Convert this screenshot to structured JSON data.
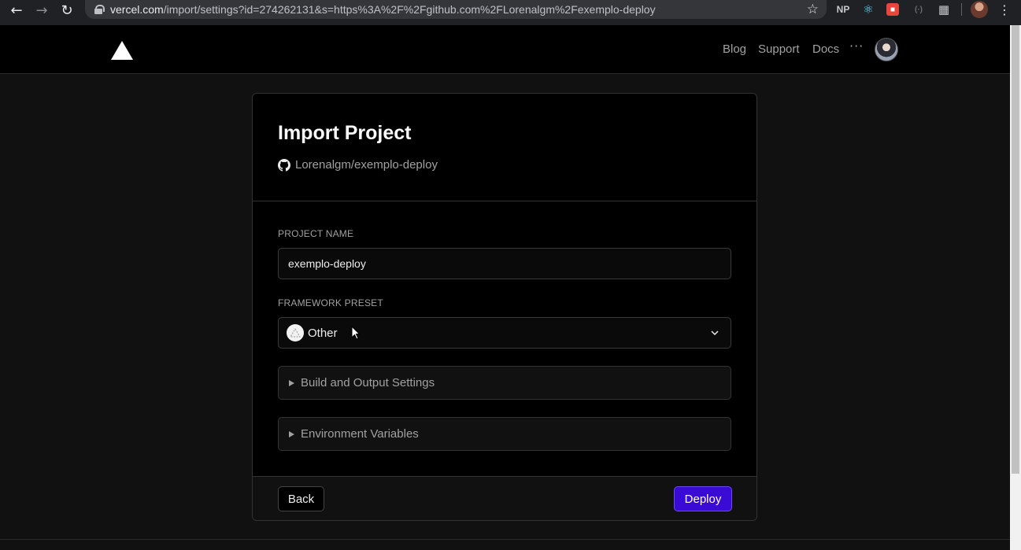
{
  "browser": {
    "url_host": "vercel.com",
    "url_path": "/import/settings?id=274262131&s=https%3A%2F%2Fgithub.com%2FLorenalgm%2Fexemplo-deploy",
    "extensions": [
      "NP"
    ]
  },
  "header": {
    "nav": {
      "blog": "Blog",
      "support": "Support",
      "docs": "Docs",
      "more": "···"
    }
  },
  "card": {
    "title": "Import Project",
    "repo": "Lorenalgm/exemplo-deploy",
    "project_name_label": "PROJECT NAME",
    "project_name_value": "exemplo-deploy",
    "framework_label": "FRAMEWORK PRESET",
    "framework_value": "Other",
    "build_settings_label": "Build and Output Settings",
    "env_vars_label": "Environment Variables",
    "back_label": "Back",
    "deploy_label": "Deploy"
  },
  "colors": {
    "background": "#111111",
    "card": "#000000",
    "accent": "#3b0bd6"
  }
}
